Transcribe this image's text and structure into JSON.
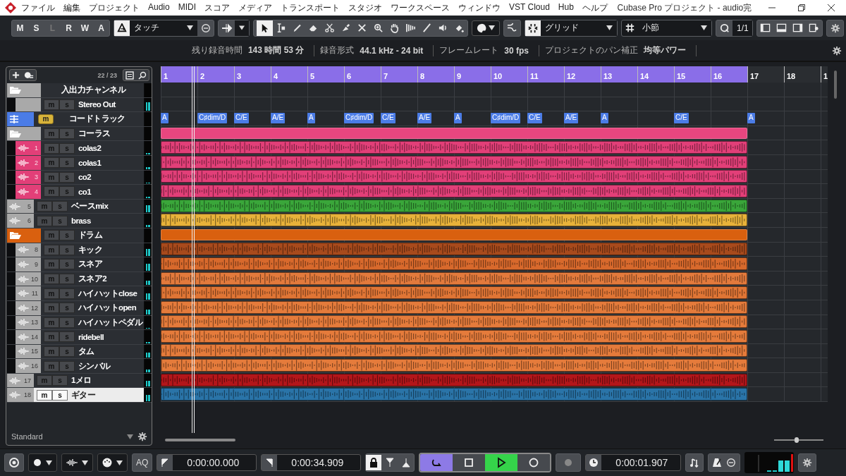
{
  "title_bar": {
    "title": "Cubase Pro プロジェクト - audio完",
    "menu": [
      "ファイル",
      "編集",
      "プロジェクト",
      "Audio",
      "MIDI",
      "スコア",
      "メディア",
      "トランスポート",
      "スタジオ",
      "ワークスペース",
      "ウィンドウ",
      "VST Cloud",
      "Hub",
      "ヘルプ"
    ]
  },
  "toolbar": {
    "automation_buttons": [
      {
        "label": "M",
        "disabled": false
      },
      {
        "label": "S",
        "disabled": false
      },
      {
        "label": "L",
        "disabled": true
      },
      {
        "label": "R",
        "disabled": false
      },
      {
        "label": "W",
        "disabled": false
      },
      {
        "label": "A",
        "disabled": false
      }
    ],
    "automation_mode": "タッチ",
    "tools": [
      {
        "kind": "select",
        "selected": true
      },
      {
        "kind": "range",
        "selected": false
      },
      {
        "kind": "draw",
        "selected": false
      },
      {
        "kind": "erase",
        "selected": false
      },
      {
        "kind": "split",
        "selected": false
      },
      {
        "kind": "glue",
        "selected": false
      },
      {
        "kind": "mute",
        "selected": false
      },
      {
        "kind": "zoom",
        "selected": false
      },
      {
        "kind": "hand",
        "selected": false
      },
      {
        "kind": "comp",
        "selected": false
      },
      {
        "kind": "line",
        "selected": false
      },
      {
        "kind": "play",
        "selected": false
      },
      {
        "kind": "color",
        "selected": false
      }
    ],
    "snap_on": true,
    "snap_type": "グリッド",
    "grid_type": "小節",
    "quantize": "1/1"
  },
  "info_line": [
    {
      "label": "残り録音時間",
      "value": "143 時間 53 分"
    },
    {
      "label": "録音形式",
      "value": "44.1 kHz - 24 bit"
    },
    {
      "label": "フレームレート",
      "value": "30 fps"
    },
    {
      "label": "プロジェクトのパン補正",
      "value": "均等パワー"
    }
  ],
  "track_list": {
    "count": "22 / 23",
    "footer": "Standard",
    "tracks": [
      {
        "kind": "folder",
        "name": "入出力チャンネル",
        "selected": false,
        "children": [
          {
            "kind": "output",
            "buttons": [
              "m",
              "s"
            ],
            "name": "Stereo Out",
            "selected": false,
            "level": 0.7
          }
        ]
      },
      {
        "kind": "chord",
        "buttons": [
          "m"
        ],
        "name": "コードトラック",
        "color": "#4b7ce6",
        "selected": false
      },
      {
        "kind": "folder",
        "buttons": [
          "m",
          "s"
        ],
        "name": "コーラス",
        "color": "#e8467f",
        "colored": false,
        "selected": false,
        "children": [
          {
            "kind": "audio",
            "number": "1",
            "buttons": [
              "m",
              "s"
            ],
            "name": "colas2",
            "color": "#e23f78",
            "colored": true,
            "selected": false,
            "level": 0.1
          },
          {
            "kind": "audio",
            "number": "2",
            "buttons": [
              "m",
              "s"
            ],
            "name": "colas1",
            "color": "#e23f78",
            "colored": true,
            "selected": false,
            "level": 0.15
          },
          {
            "kind": "audio",
            "number": "3",
            "buttons": [
              "m",
              "s"
            ],
            "name": "co2",
            "color": "#e23f78",
            "colored": true,
            "selected": false,
            "level": 0.08
          },
          {
            "kind": "audio",
            "number": "4",
            "buttons": [
              "m",
              "s"
            ],
            "name": "co1",
            "color": "#e23f78",
            "colored": true,
            "selected": false,
            "level": 0.08
          }
        ]
      },
      {
        "kind": "audio",
        "number": "5",
        "buttons": [
          "m",
          "s"
        ],
        "name": "ベースmix",
        "color": "#3aa63a",
        "colored": false,
        "selected": false,
        "level": 0.6
      },
      {
        "kind": "audio",
        "number": "6",
        "buttons": [
          "m",
          "s"
        ],
        "name": "brass",
        "color": "#e8b23a",
        "colored": false,
        "selected": false,
        "level": 0.15
      },
      {
        "kind": "folder",
        "buttons": [
          "m",
          "s"
        ],
        "name": "ドラム",
        "color": "#d9600f",
        "colored": true,
        "selected": false,
        "children": [
          {
            "kind": "audio",
            "number": "8",
            "buttons": [
              "m",
              "s"
            ],
            "name": "キック",
            "color": "#a84a1c",
            "colored": false,
            "selected": false,
            "level": 0.6
          },
          {
            "kind": "audio",
            "number": "9",
            "buttons": [
              "m",
              "s"
            ],
            "name": "スネア",
            "color": "#d8692c",
            "colored": false,
            "selected": false,
            "level": 0.6
          },
          {
            "kind": "audio",
            "number": "10",
            "buttons": [
              "m",
              "s"
            ],
            "name": "スネア2",
            "color": "#e37a3c",
            "colored": false,
            "selected": false,
            "level": 0.4
          },
          {
            "kind": "audio",
            "number": "11",
            "buttons": [
              "m",
              "s"
            ],
            "name": "ハイハットclose",
            "color": "#e07535",
            "colored": false,
            "selected": false,
            "level": 0.5
          },
          {
            "kind": "audio",
            "number": "12",
            "buttons": [
              "m",
              "s"
            ],
            "name": "ハイハットopen",
            "color": "#e57b3b",
            "colored": false,
            "selected": false,
            "level": 0.4
          },
          {
            "kind": "audio",
            "number": "13",
            "buttons": [
              "m",
              "s"
            ],
            "name": "ハイハットペダル",
            "color": "#e57b3b",
            "colored": false,
            "selected": false,
            "level": 0.08
          },
          {
            "kind": "audio",
            "number": "14",
            "buttons": [
              "m",
              "s"
            ],
            "name": "ridebell",
            "color": "#e57b3b",
            "colored": false,
            "selected": false,
            "level": 0.08
          },
          {
            "kind": "audio",
            "number": "15",
            "buttons": [
              "m",
              "s"
            ],
            "name": "タム",
            "color": "#e57b3b",
            "colored": false,
            "selected": false,
            "level": 0.4
          },
          {
            "kind": "audio",
            "number": "16",
            "buttons": [
              "m",
              "s"
            ],
            "name": "シンバル",
            "color": "#e57b3b",
            "colored": false,
            "selected": false,
            "level": 0.25
          }
        ]
      },
      {
        "kind": "audio",
        "number": "17",
        "buttons": [
          "m",
          "s"
        ],
        "name": "1メロ",
        "color": "#b3161a",
        "colored": false,
        "selected": false,
        "level": 0.5
      },
      {
        "kind": "audio",
        "number": "18",
        "buttons": [
          "m",
          "s"
        ],
        "name": "ギター",
        "color": "#2a74a8",
        "colored": false,
        "selected": true,
        "level": 0.55
      }
    ]
  },
  "ruler": [
    {
      "label": "1",
      "in_range": true
    },
    {
      "label": "2",
      "in_range": true
    },
    {
      "label": "3",
      "in_range": true
    },
    {
      "label": "4",
      "in_range": true
    },
    {
      "label": "5",
      "in_range": true
    },
    {
      "label": "6",
      "in_range": true
    },
    {
      "label": "7",
      "in_range": true
    },
    {
      "label": "8",
      "in_range": true
    },
    {
      "label": "9",
      "in_range": true
    },
    {
      "label": "10",
      "in_range": true
    },
    {
      "label": "11",
      "in_range": true
    },
    {
      "label": "12",
      "in_range": true
    },
    {
      "label": "13",
      "in_range": true
    },
    {
      "label": "14",
      "in_range": true
    },
    {
      "label": "15",
      "in_range": true
    },
    {
      "label": "16",
      "in_range": true
    },
    {
      "label": "17",
      "in_range": false
    },
    {
      "label": "18",
      "in_range": false
    },
    {
      "label": "1",
      "in_range": false
    }
  ],
  "chord_events": [
    {
      "symbol": "A",
      "sustained": false
    },
    {
      "symbol": "C♯dim/D",
      "sustained": false
    },
    {
      "symbol": "C/E",
      "sustained": false
    },
    {
      "symbol": "A/E",
      "sustained": false
    },
    {
      "symbol": "A",
      "sustained": false
    },
    {
      "symbol": "C♯dim/D",
      "sustained": false
    },
    {
      "symbol": "C/E",
      "sustained": false
    },
    {
      "symbol": "A/E",
      "sustained": false
    },
    {
      "symbol": "A",
      "sustained": false
    },
    {
      "symbol": "C♯dim/D",
      "sustained": false
    },
    {
      "symbol": "C/E",
      "sustained": false
    },
    {
      "symbol": "A/E",
      "sustained": false
    },
    {
      "symbol": "A",
      "sustained": true
    },
    {
      "symbol": "C/E",
      "sustained": true
    },
    {
      "symbol": "A",
      "sustained": false
    }
  ],
  "zoom_slider": {
    "level": 0.45
  },
  "transport": {
    "aq": "AQ",
    "left_locator": "0:00:00.000",
    "right_locator": "0:00:34.909",
    "buttons": [
      {
        "kind": "cycle",
        "on": true
      },
      {
        "kind": "stop",
        "on": false
      },
      {
        "kind": "play",
        "on": true
      },
      {
        "kind": "record",
        "on": false
      }
    ],
    "position": "0:00:01.907"
  }
}
